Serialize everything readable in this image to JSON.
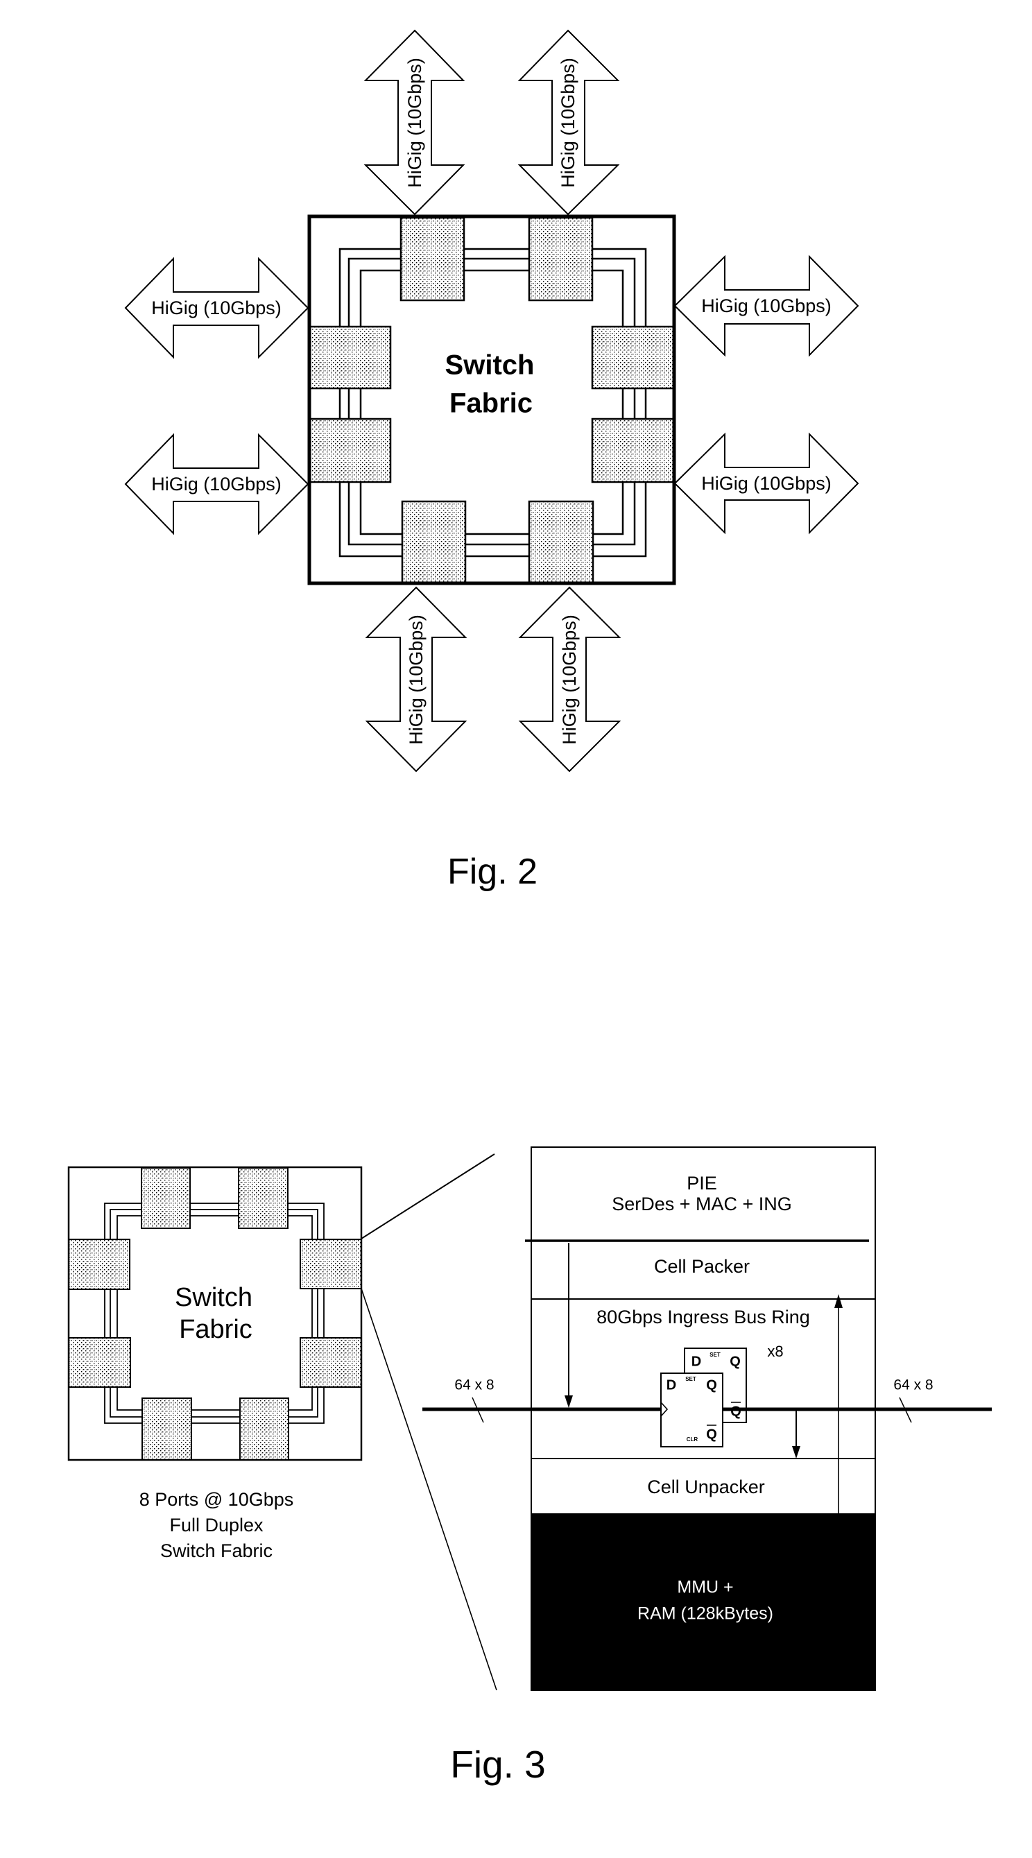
{
  "figures": {
    "fig2": {
      "caption": "Fig. 2",
      "center_label": [
        "Switch",
        "Fabric"
      ],
      "ports": [
        {
          "id": "top-left",
          "side": "top",
          "label": "HiGig (10Gbps)"
        },
        {
          "id": "top-right",
          "side": "top",
          "label": "HiGig (10Gbps)"
        },
        {
          "id": "left-upper",
          "side": "left",
          "label": "HiGig (10Gbps)"
        },
        {
          "id": "left-lower",
          "side": "left",
          "label": "HiGig (10Gbps)"
        },
        {
          "id": "right-upper",
          "side": "right",
          "label": "HiGig (10Gbps)"
        },
        {
          "id": "right-lower",
          "side": "right",
          "label": "HiGig (10Gbps)"
        },
        {
          "id": "bottom-left",
          "side": "bottom",
          "label": "HiGig (10Gbps)"
        },
        {
          "id": "bottom-right",
          "side": "bottom",
          "label": "HiGig (10Gbps)"
        }
      ]
    },
    "fig3": {
      "caption": "Fig. 3",
      "fabric_label": [
        "Switch",
        "Fabric"
      ],
      "fabric_description": [
        "8 Ports @ 10Gbps",
        "Full Duplex",
        "Switch Fabric"
      ],
      "port_detail": {
        "pie_block": [
          "PIE",
          "SerDes + MAC + ING"
        ],
        "cell_packer": "Cell Packer",
        "bus_ring": "80Gbps Ingress Bus Ring",
        "flipflop_replication": "x8",
        "flipflop": {
          "d": "D",
          "q": "Q",
          "q_bar": "Q",
          "set": "SET",
          "clr": "CLR"
        },
        "bus_width_left": "64 x 8",
        "bus_width_right": "64 x 8",
        "cell_unpacker": "Cell Unpacker",
        "mmu_block": [
          "MMU +",
          "RAM (128kBytes)"
        ]
      }
    }
  },
  "colors": {
    "ink": "#000000",
    "paper": "#ffffff",
    "mmu_fill": "#000000",
    "mmu_text": "#ffffff"
  }
}
